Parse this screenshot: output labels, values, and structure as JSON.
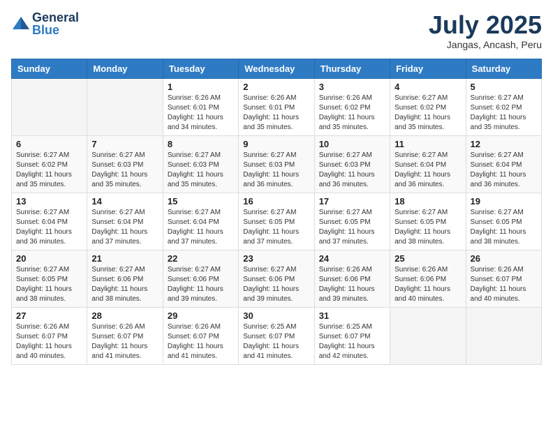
{
  "logo": {
    "general": "General",
    "blue": "Blue"
  },
  "title": {
    "month_year": "July 2025",
    "location": "Jangas, Ancash, Peru"
  },
  "days_of_week": [
    "Sunday",
    "Monday",
    "Tuesday",
    "Wednesday",
    "Thursday",
    "Friday",
    "Saturday"
  ],
  "weeks": [
    [
      {
        "day": "",
        "info": ""
      },
      {
        "day": "",
        "info": ""
      },
      {
        "day": "1",
        "info": "Sunrise: 6:26 AM\nSunset: 6:01 PM\nDaylight: 11 hours and 34 minutes."
      },
      {
        "day": "2",
        "info": "Sunrise: 6:26 AM\nSunset: 6:01 PM\nDaylight: 11 hours and 35 minutes."
      },
      {
        "day": "3",
        "info": "Sunrise: 6:26 AM\nSunset: 6:02 PM\nDaylight: 11 hours and 35 minutes."
      },
      {
        "day": "4",
        "info": "Sunrise: 6:27 AM\nSunset: 6:02 PM\nDaylight: 11 hours and 35 minutes."
      },
      {
        "day": "5",
        "info": "Sunrise: 6:27 AM\nSunset: 6:02 PM\nDaylight: 11 hours and 35 minutes."
      }
    ],
    [
      {
        "day": "6",
        "info": "Sunrise: 6:27 AM\nSunset: 6:02 PM\nDaylight: 11 hours and 35 minutes."
      },
      {
        "day": "7",
        "info": "Sunrise: 6:27 AM\nSunset: 6:03 PM\nDaylight: 11 hours and 35 minutes."
      },
      {
        "day": "8",
        "info": "Sunrise: 6:27 AM\nSunset: 6:03 PM\nDaylight: 11 hours and 35 minutes."
      },
      {
        "day": "9",
        "info": "Sunrise: 6:27 AM\nSunset: 6:03 PM\nDaylight: 11 hours and 36 minutes."
      },
      {
        "day": "10",
        "info": "Sunrise: 6:27 AM\nSunset: 6:03 PM\nDaylight: 11 hours and 36 minutes."
      },
      {
        "day": "11",
        "info": "Sunrise: 6:27 AM\nSunset: 6:04 PM\nDaylight: 11 hours and 36 minutes."
      },
      {
        "day": "12",
        "info": "Sunrise: 6:27 AM\nSunset: 6:04 PM\nDaylight: 11 hours and 36 minutes."
      }
    ],
    [
      {
        "day": "13",
        "info": "Sunrise: 6:27 AM\nSunset: 6:04 PM\nDaylight: 11 hours and 36 minutes."
      },
      {
        "day": "14",
        "info": "Sunrise: 6:27 AM\nSunset: 6:04 PM\nDaylight: 11 hours and 37 minutes."
      },
      {
        "day": "15",
        "info": "Sunrise: 6:27 AM\nSunset: 6:04 PM\nDaylight: 11 hours and 37 minutes."
      },
      {
        "day": "16",
        "info": "Sunrise: 6:27 AM\nSunset: 6:05 PM\nDaylight: 11 hours and 37 minutes."
      },
      {
        "day": "17",
        "info": "Sunrise: 6:27 AM\nSunset: 6:05 PM\nDaylight: 11 hours and 37 minutes."
      },
      {
        "day": "18",
        "info": "Sunrise: 6:27 AM\nSunset: 6:05 PM\nDaylight: 11 hours and 38 minutes."
      },
      {
        "day": "19",
        "info": "Sunrise: 6:27 AM\nSunset: 6:05 PM\nDaylight: 11 hours and 38 minutes."
      }
    ],
    [
      {
        "day": "20",
        "info": "Sunrise: 6:27 AM\nSunset: 6:05 PM\nDaylight: 11 hours and 38 minutes."
      },
      {
        "day": "21",
        "info": "Sunrise: 6:27 AM\nSunset: 6:06 PM\nDaylight: 11 hours and 38 minutes."
      },
      {
        "day": "22",
        "info": "Sunrise: 6:27 AM\nSunset: 6:06 PM\nDaylight: 11 hours and 39 minutes."
      },
      {
        "day": "23",
        "info": "Sunrise: 6:27 AM\nSunset: 6:06 PM\nDaylight: 11 hours and 39 minutes."
      },
      {
        "day": "24",
        "info": "Sunrise: 6:26 AM\nSunset: 6:06 PM\nDaylight: 11 hours and 39 minutes."
      },
      {
        "day": "25",
        "info": "Sunrise: 6:26 AM\nSunset: 6:06 PM\nDaylight: 11 hours and 40 minutes."
      },
      {
        "day": "26",
        "info": "Sunrise: 6:26 AM\nSunset: 6:07 PM\nDaylight: 11 hours and 40 minutes."
      }
    ],
    [
      {
        "day": "27",
        "info": "Sunrise: 6:26 AM\nSunset: 6:07 PM\nDaylight: 11 hours and 40 minutes."
      },
      {
        "day": "28",
        "info": "Sunrise: 6:26 AM\nSunset: 6:07 PM\nDaylight: 11 hours and 41 minutes."
      },
      {
        "day": "29",
        "info": "Sunrise: 6:26 AM\nSunset: 6:07 PM\nDaylight: 11 hours and 41 minutes."
      },
      {
        "day": "30",
        "info": "Sunrise: 6:25 AM\nSunset: 6:07 PM\nDaylight: 11 hours and 41 minutes."
      },
      {
        "day": "31",
        "info": "Sunrise: 6:25 AM\nSunset: 6:07 PM\nDaylight: 11 hours and 42 minutes."
      },
      {
        "day": "",
        "info": ""
      },
      {
        "day": "",
        "info": ""
      }
    ]
  ]
}
